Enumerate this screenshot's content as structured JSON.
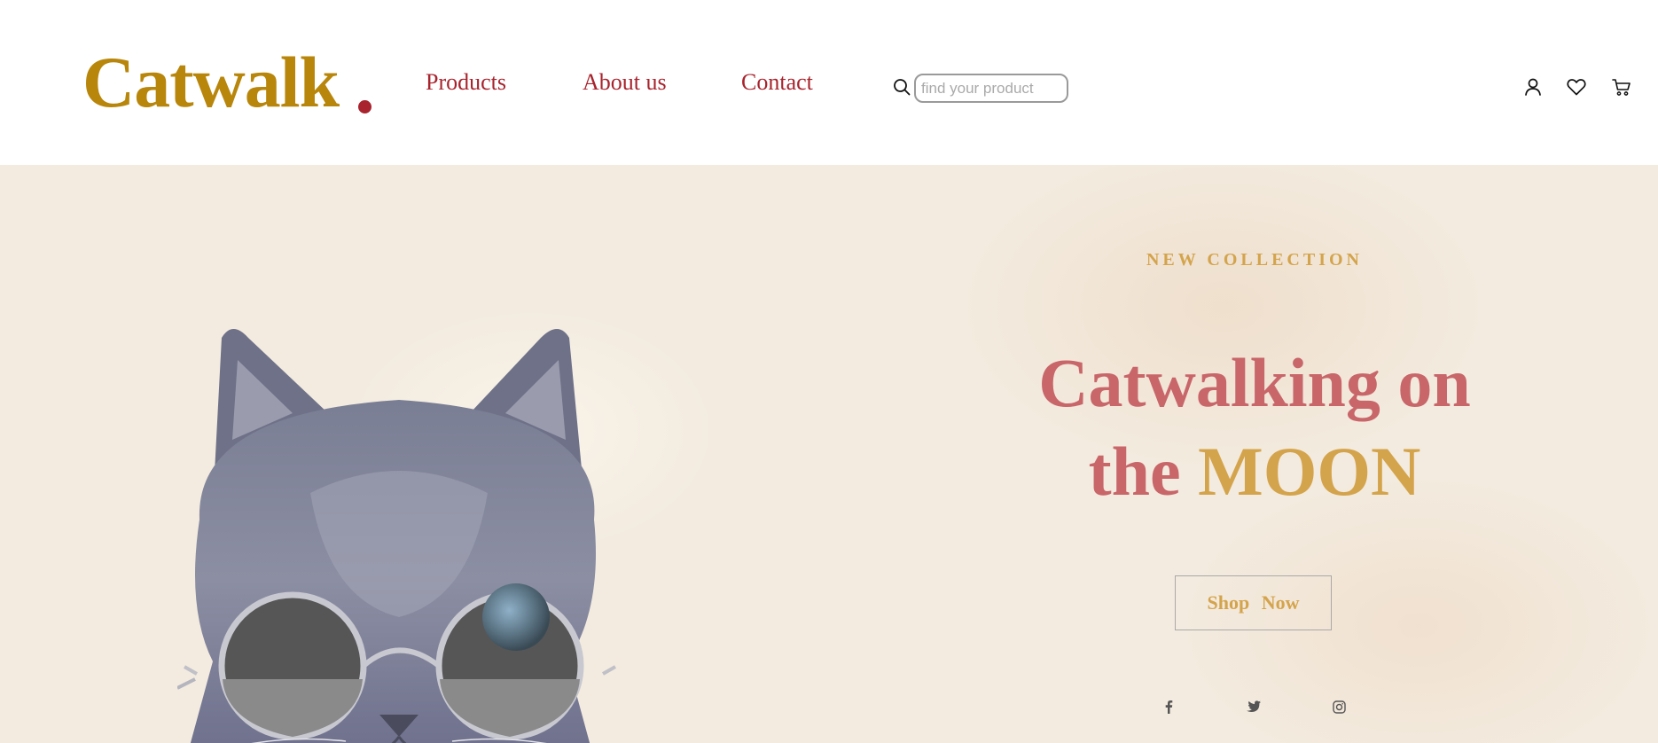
{
  "header": {
    "logo_text": "Catwalk",
    "nav": {
      "products": "Products",
      "about": "About us",
      "contact": "Contact"
    },
    "search": {
      "placeholder": "find your product",
      "value": ""
    },
    "icons": [
      "search-icon",
      "user-icon",
      "heart-icon",
      "cart-icon"
    ]
  },
  "hero": {
    "eyebrow": "NEW COLLECTION",
    "headline_line1": "Catwalking on",
    "headline_the": "the",
    "headline_moon": "MOON",
    "cta_label": "Shop Now",
    "social_icons": [
      "facebook-icon",
      "twitter-icon",
      "instagram-icon"
    ]
  },
  "colors": {
    "brand_gold": "#b8860b",
    "accent_red": "#a8232d",
    "headline_rose": "#c8666a",
    "moon_gold": "#d4a44c",
    "hero_background": "#f3ebdf"
  }
}
